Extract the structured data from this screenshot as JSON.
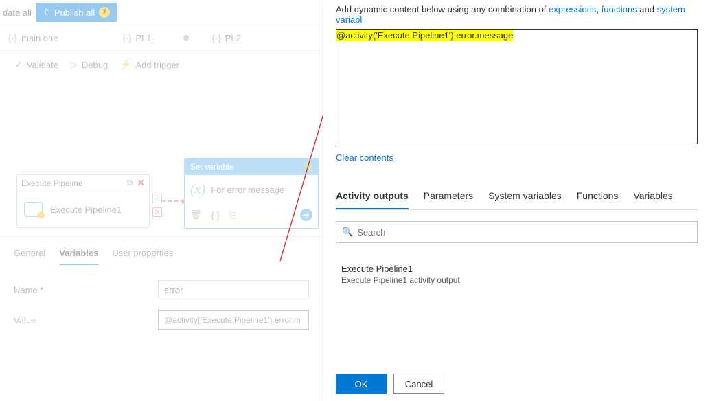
{
  "topbar": {
    "date_all": "date all",
    "publish_label": "Publish all",
    "publish_count": "7"
  },
  "tabs": [
    {
      "label": "main one"
    },
    {
      "label": "PL1"
    },
    {
      "label": "PL2"
    }
  ],
  "toolbar": {
    "validate": "Validate",
    "debug": "Debug",
    "add_trigger": "Add trigger"
  },
  "canvas": {
    "exec_pipeline": {
      "header": "Execute Pipeline",
      "name": "Execute Pipeline1"
    },
    "set_var": {
      "header": "Set variable",
      "title": "For error message"
    }
  },
  "bottom_tabs": {
    "general": "General",
    "variables": "Variables",
    "user_props": "User properties"
  },
  "form": {
    "name_label": "Name",
    "name_req": "*",
    "name_value": "error",
    "value_label": "Value",
    "value_value": "@activity('Execute Pipeline1').error.m"
  },
  "right": {
    "help_prefix": "Add dynamic content below using any combination of ",
    "help_link1": "expressions",
    "help_comma": ", ",
    "help_link2": "functions",
    "help_and": " and ",
    "help_link3": "system variabl",
    "expression": "@activity('Execute Pipeline1').error.message",
    "clear": "Clear contents",
    "tabs": {
      "activity": "Activity outputs",
      "parameters": "Parameters",
      "sysvars": "System variables",
      "functions": "Functions",
      "variables": "Variables"
    },
    "search_placeholder": "Search",
    "result": {
      "title": "Execute Pipeline1",
      "sub": "Execute Pipeline1 activity output"
    },
    "ok": "OK",
    "cancel": "Cancel"
  }
}
